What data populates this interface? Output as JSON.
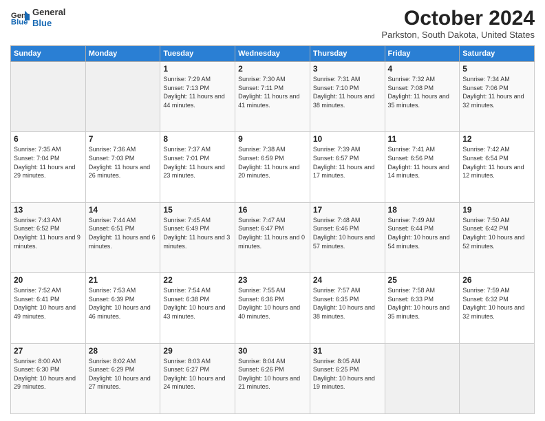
{
  "header": {
    "logo_line1": "General",
    "logo_line2": "Blue",
    "month": "October 2024",
    "location": "Parkston, South Dakota, United States"
  },
  "weekdays": [
    "Sunday",
    "Monday",
    "Tuesday",
    "Wednesday",
    "Thursday",
    "Friday",
    "Saturday"
  ],
  "weeks": [
    [
      {
        "day": "",
        "info": ""
      },
      {
        "day": "",
        "info": ""
      },
      {
        "day": "1",
        "info": "Sunrise: 7:29 AM\nSunset: 7:13 PM\nDaylight: 11 hours and 44 minutes."
      },
      {
        "day": "2",
        "info": "Sunrise: 7:30 AM\nSunset: 7:11 PM\nDaylight: 11 hours and 41 minutes."
      },
      {
        "day": "3",
        "info": "Sunrise: 7:31 AM\nSunset: 7:10 PM\nDaylight: 11 hours and 38 minutes."
      },
      {
        "day": "4",
        "info": "Sunrise: 7:32 AM\nSunset: 7:08 PM\nDaylight: 11 hours and 35 minutes."
      },
      {
        "day": "5",
        "info": "Sunrise: 7:34 AM\nSunset: 7:06 PM\nDaylight: 11 hours and 32 minutes."
      }
    ],
    [
      {
        "day": "6",
        "info": "Sunrise: 7:35 AM\nSunset: 7:04 PM\nDaylight: 11 hours and 29 minutes."
      },
      {
        "day": "7",
        "info": "Sunrise: 7:36 AM\nSunset: 7:03 PM\nDaylight: 11 hours and 26 minutes."
      },
      {
        "day": "8",
        "info": "Sunrise: 7:37 AM\nSunset: 7:01 PM\nDaylight: 11 hours and 23 minutes."
      },
      {
        "day": "9",
        "info": "Sunrise: 7:38 AM\nSunset: 6:59 PM\nDaylight: 11 hours and 20 minutes."
      },
      {
        "day": "10",
        "info": "Sunrise: 7:39 AM\nSunset: 6:57 PM\nDaylight: 11 hours and 17 minutes."
      },
      {
        "day": "11",
        "info": "Sunrise: 7:41 AM\nSunset: 6:56 PM\nDaylight: 11 hours and 14 minutes."
      },
      {
        "day": "12",
        "info": "Sunrise: 7:42 AM\nSunset: 6:54 PM\nDaylight: 11 hours and 12 minutes."
      }
    ],
    [
      {
        "day": "13",
        "info": "Sunrise: 7:43 AM\nSunset: 6:52 PM\nDaylight: 11 hours and 9 minutes."
      },
      {
        "day": "14",
        "info": "Sunrise: 7:44 AM\nSunset: 6:51 PM\nDaylight: 11 hours and 6 minutes."
      },
      {
        "day": "15",
        "info": "Sunrise: 7:45 AM\nSunset: 6:49 PM\nDaylight: 11 hours and 3 minutes."
      },
      {
        "day": "16",
        "info": "Sunrise: 7:47 AM\nSunset: 6:47 PM\nDaylight: 11 hours and 0 minutes."
      },
      {
        "day": "17",
        "info": "Sunrise: 7:48 AM\nSunset: 6:46 PM\nDaylight: 10 hours and 57 minutes."
      },
      {
        "day": "18",
        "info": "Sunrise: 7:49 AM\nSunset: 6:44 PM\nDaylight: 10 hours and 54 minutes."
      },
      {
        "day": "19",
        "info": "Sunrise: 7:50 AM\nSunset: 6:42 PM\nDaylight: 10 hours and 52 minutes."
      }
    ],
    [
      {
        "day": "20",
        "info": "Sunrise: 7:52 AM\nSunset: 6:41 PM\nDaylight: 10 hours and 49 minutes."
      },
      {
        "day": "21",
        "info": "Sunrise: 7:53 AM\nSunset: 6:39 PM\nDaylight: 10 hours and 46 minutes."
      },
      {
        "day": "22",
        "info": "Sunrise: 7:54 AM\nSunset: 6:38 PM\nDaylight: 10 hours and 43 minutes."
      },
      {
        "day": "23",
        "info": "Sunrise: 7:55 AM\nSunset: 6:36 PM\nDaylight: 10 hours and 40 minutes."
      },
      {
        "day": "24",
        "info": "Sunrise: 7:57 AM\nSunset: 6:35 PM\nDaylight: 10 hours and 38 minutes."
      },
      {
        "day": "25",
        "info": "Sunrise: 7:58 AM\nSunset: 6:33 PM\nDaylight: 10 hours and 35 minutes."
      },
      {
        "day": "26",
        "info": "Sunrise: 7:59 AM\nSunset: 6:32 PM\nDaylight: 10 hours and 32 minutes."
      }
    ],
    [
      {
        "day": "27",
        "info": "Sunrise: 8:00 AM\nSunset: 6:30 PM\nDaylight: 10 hours and 29 minutes."
      },
      {
        "day": "28",
        "info": "Sunrise: 8:02 AM\nSunset: 6:29 PM\nDaylight: 10 hours and 27 minutes."
      },
      {
        "day": "29",
        "info": "Sunrise: 8:03 AM\nSunset: 6:27 PM\nDaylight: 10 hours and 24 minutes."
      },
      {
        "day": "30",
        "info": "Sunrise: 8:04 AM\nSunset: 6:26 PM\nDaylight: 10 hours and 21 minutes."
      },
      {
        "day": "31",
        "info": "Sunrise: 8:05 AM\nSunset: 6:25 PM\nDaylight: 10 hours and 19 minutes."
      },
      {
        "day": "",
        "info": ""
      },
      {
        "day": "",
        "info": ""
      }
    ]
  ]
}
